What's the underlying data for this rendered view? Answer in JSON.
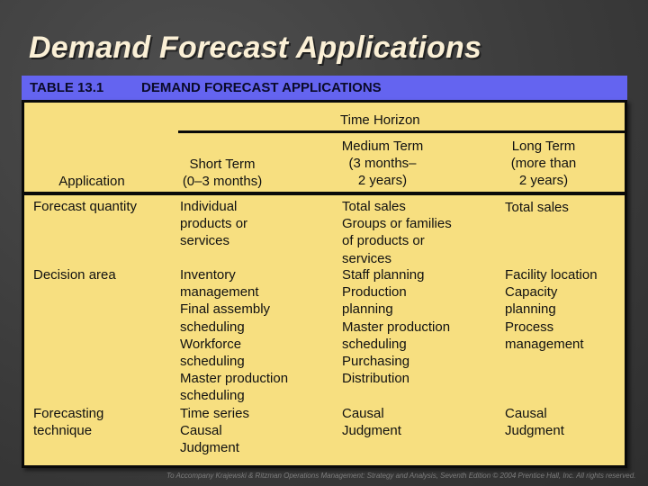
{
  "slide": {
    "title": "Demand Forecast Applications",
    "footer": "To Accompany Krajewski & Ritzman Operations Management: Strategy and Analysis, Seventh Edition © 2004 Prentice Hall, Inc. All rights reserved."
  },
  "table": {
    "number": "TABLE 13.1",
    "caption": "DEMAND FORECAST APPLICATIONS",
    "group_header": "Time Horizon",
    "columns": {
      "application": "Application",
      "short": [
        "Short Term",
        "(0–3 months)"
      ],
      "medium": [
        "Medium Term",
        "(3 months–",
        "2 years)"
      ],
      "long": [
        "Long Term",
        "(more than",
        "2 years)"
      ]
    },
    "rows": [
      {
        "application": [
          "Forecast quantity"
        ],
        "short": [
          "Individual",
          "products or",
          "services"
        ],
        "medium": [
          "Total sales",
          "Groups or families",
          "of products or",
          "services"
        ],
        "long": [
          "Total sales"
        ]
      },
      {
        "application": [
          "Decision area"
        ],
        "short": [
          "Inventory",
          "management",
          "Final assembly",
          "scheduling",
          "Workforce",
          "scheduling",
          "Master production",
          "scheduling"
        ],
        "medium": [
          "Staff planning",
          "Production",
          "planning",
          "Master production",
          "scheduling",
          "Purchasing",
          "Distribution"
        ],
        "long": [
          "Facility location",
          "Capacity",
          "planning",
          "Process",
          "management"
        ]
      },
      {
        "application": [
          "Forecasting",
          "technique"
        ],
        "short": [
          "Time series",
          "Causal",
          "Judgment"
        ],
        "medium": [
          "Causal",
          "Judgment"
        ],
        "long": [
          "Causal",
          "Judgment"
        ]
      }
    ]
  },
  "colors": {
    "band": "#6464f0",
    "table_bg": "#f7df80",
    "title_text": "#fbf0d6"
  }
}
